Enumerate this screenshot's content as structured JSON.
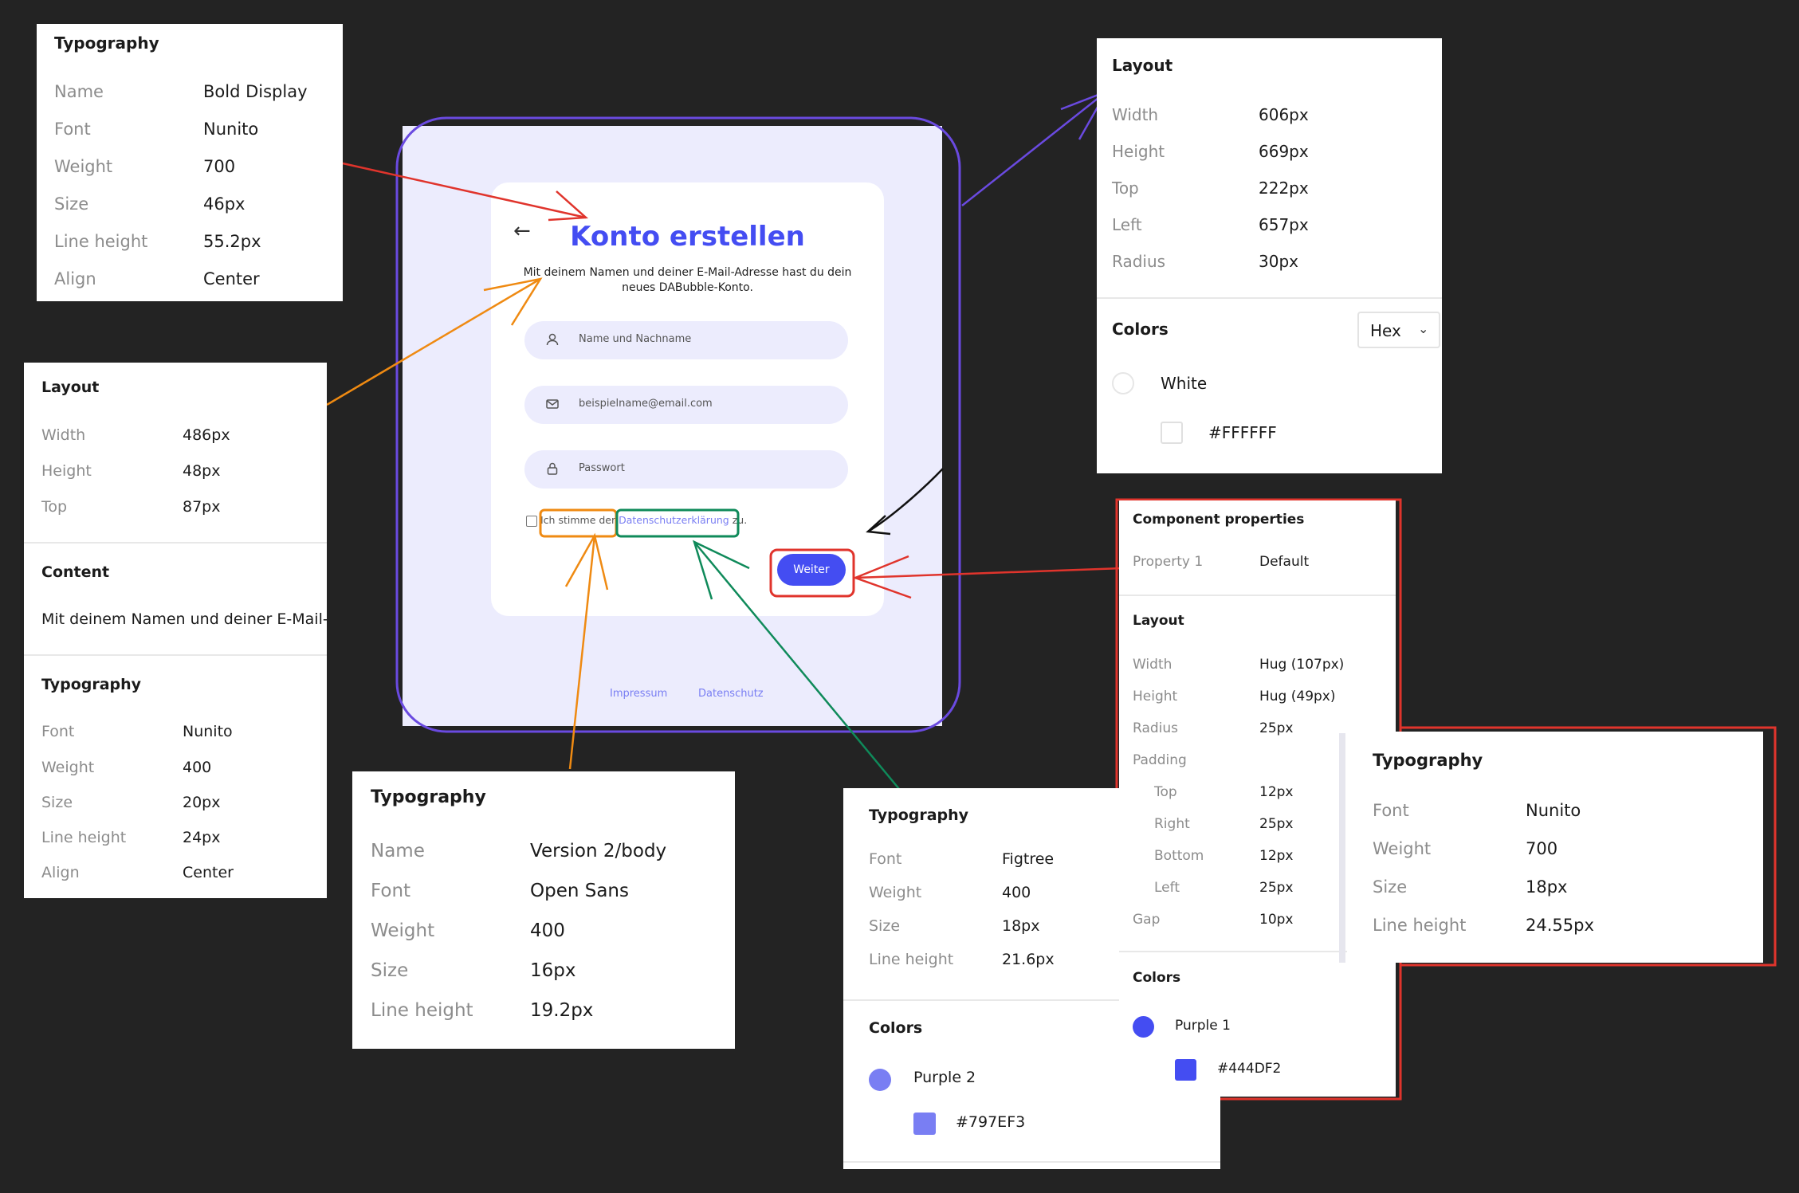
{
  "colors": {
    "background": "#232323",
    "purple_primary": "#444DF2",
    "purple_light": "#797EF3",
    "surface": "#ECECFD"
  },
  "mockup": {
    "title": "Konto erstellen",
    "back_icon": "arrow-left-icon",
    "subtitle": "Mit deinem Namen und deiner E-Mail-Adresse hast du dein neues DABubble-Konto.",
    "fields": [
      {
        "icon": "user-icon",
        "placeholder": "Name und Nachname"
      },
      {
        "icon": "mail-icon",
        "placeholder": "beispielname@email.com"
      },
      {
        "icon": "lock-icon",
        "placeholder": "Passwort"
      }
    ],
    "agree_prefix": "Ich stimme der",
    "agree_link": "Datenschutzerklärung",
    "agree_suffix": "zu.",
    "button": "Weiter",
    "footer": [
      "Impressum",
      "Datenschutz"
    ]
  },
  "panel_title": {
    "heading": "Typography",
    "rows": [
      {
        "k": "Name",
        "v": "Bold Display"
      },
      {
        "k": "Font",
        "v": "Nunito"
      },
      {
        "k": "Weight",
        "v": "700"
      },
      {
        "k": "Size",
        "v": "46px"
      },
      {
        "k": "Line height",
        "v": "55.2px"
      },
      {
        "k": "Align",
        "v": "Center"
      }
    ]
  },
  "panel_subtitle": {
    "layout_heading": "Layout",
    "layout_rows": [
      {
        "k": "Width",
        "v": "486px"
      },
      {
        "k": "Height",
        "v": "48px"
      },
      {
        "k": "Top",
        "v": "87px"
      }
    ],
    "content_heading": "Content",
    "content_text": "Mit deinem Namen und deiner E-Mail-",
    "typo_heading": "Typography",
    "typo_rows": [
      {
        "k": "Font",
        "v": "Nunito"
      },
      {
        "k": "Weight",
        "v": "400"
      },
      {
        "k": "Size",
        "v": "20px"
      },
      {
        "k": "Line height",
        "v": "24px"
      },
      {
        "k": "Align",
        "v": "Center"
      }
    ]
  },
  "panel_checkbox": {
    "heading": "Typography",
    "rows": [
      {
        "k": "Name",
        "v": "Version 2/body"
      },
      {
        "k": "Font",
        "v": "Open Sans"
      },
      {
        "k": "Weight",
        "v": "400"
      },
      {
        "k": "Size",
        "v": "16px"
      },
      {
        "k": "Line height",
        "v": "19.2px"
      }
    ]
  },
  "panel_link": {
    "heading": "Typography",
    "rows": [
      {
        "k": "Font",
        "v": "Figtree"
      },
      {
        "k": "Weight",
        "v": "400"
      },
      {
        "k": "Size",
        "v": "18px"
      },
      {
        "k": "Line height",
        "v": "21.6px"
      }
    ],
    "colors_heading": "Colors",
    "color_name": "Purple 2",
    "color_hex": "#797EF3"
  },
  "panel_layout": {
    "heading": "Layout",
    "rows": [
      {
        "k": "Width",
        "v": "606px"
      },
      {
        "k": "Height",
        "v": "669px"
      },
      {
        "k": "Top",
        "v": "222px"
      },
      {
        "k": "Left",
        "v": "657px"
      },
      {
        "k": "Radius",
        "v": "30px"
      }
    ],
    "colors_heading": "Colors",
    "format": "Hex",
    "color_name": "White",
    "color_hex": "#FFFFFF"
  },
  "panel_component": {
    "heading": "Component properties",
    "prop_key": "Property 1",
    "prop_value": "Default",
    "layout_heading": "Layout",
    "rows": [
      {
        "k": "Width",
        "v": "Hug (107px)"
      },
      {
        "k": "Height",
        "v": "Hug (49px)"
      },
      {
        "k": "Radius",
        "v": "25px"
      },
      {
        "k": "Padding",
        "v": ""
      },
      {
        "k": "Top",
        "v": "12px"
      },
      {
        "k": "Right",
        "v": "25px"
      },
      {
        "k": "Bottom",
        "v": "12px"
      },
      {
        "k": "Left",
        "v": "25px"
      },
      {
        "k": "Gap",
        "v": "10px"
      }
    ],
    "colors_heading": "Colors",
    "color_name": "Purple 1",
    "color_hex": "#444DF2"
  },
  "panel_button_typo": {
    "heading": "Typography",
    "rows": [
      {
        "k": "Font",
        "v": "Nunito"
      },
      {
        "k": "Weight",
        "v": "700"
      },
      {
        "k": "Size",
        "v": "18px"
      },
      {
        "k": "Line height",
        "v": "24.55px"
      }
    ]
  }
}
